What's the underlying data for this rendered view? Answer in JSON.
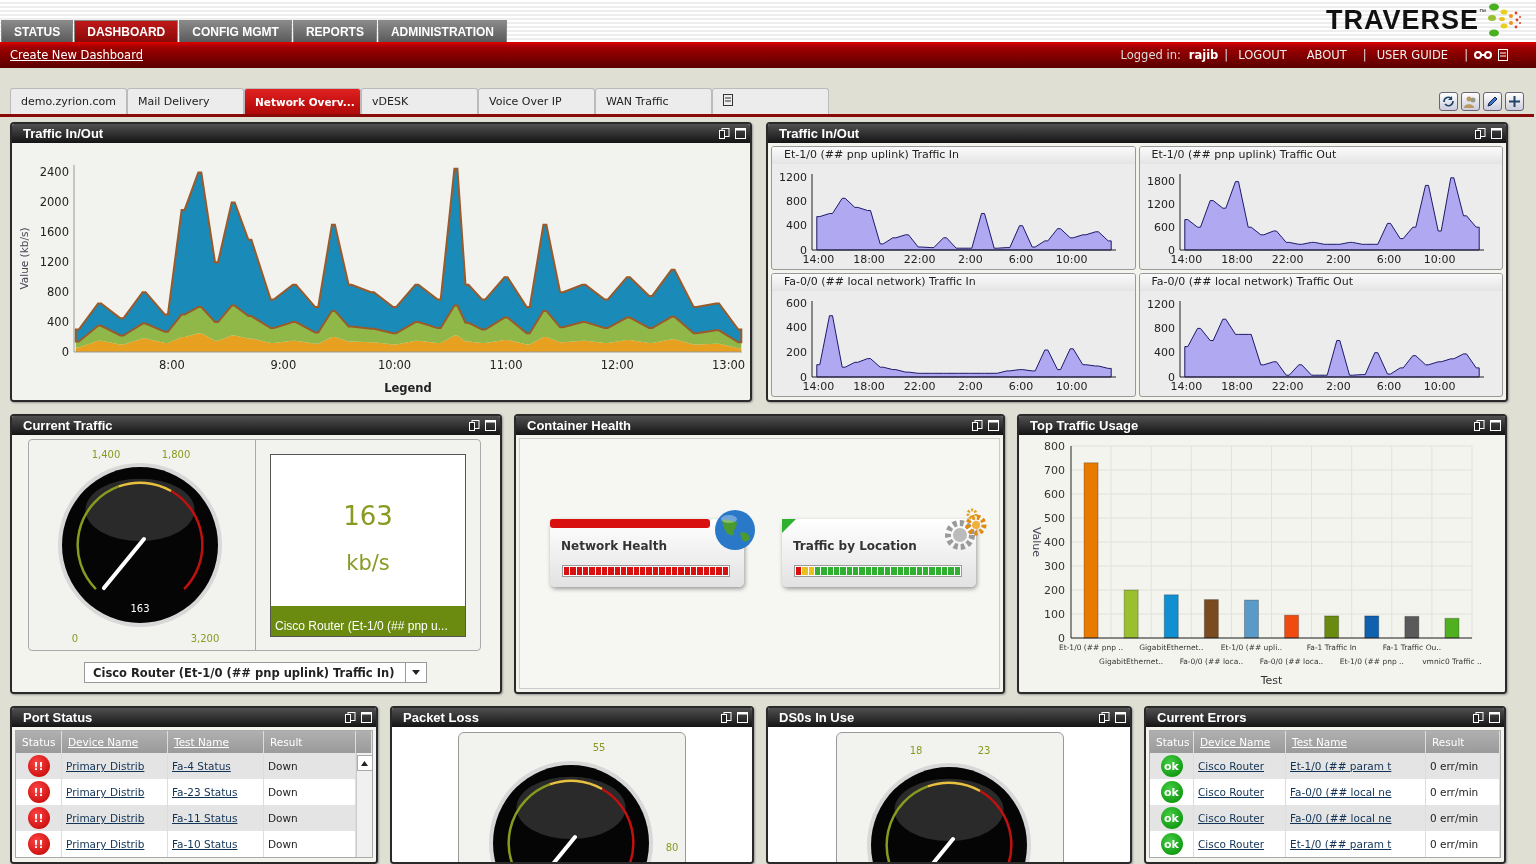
{
  "header": {
    "logo": "TRAVERSE",
    "logo_tm": "™",
    "nav": [
      {
        "label": "STATUS",
        "selected": false
      },
      {
        "label": "DASHBOARD",
        "selected": true
      },
      {
        "label": "CONFIG MGMT",
        "selected": false
      },
      {
        "label": "REPORTS",
        "selected": false
      },
      {
        "label": "ADMINISTRATION",
        "selected": false
      }
    ],
    "create_link": "Create New Dashboard",
    "account": [
      {
        "kind": "label",
        "text": "Logged in:"
      },
      {
        "kind": "user",
        "text": "rajib"
      },
      {
        "kind": "sep",
        "text": "|"
      },
      {
        "kind": "link",
        "text": "LOGOUT"
      },
      {
        "kind": "link",
        "text": "ABOUT"
      },
      {
        "kind": "sep",
        "text": "|"
      },
      {
        "kind": "link",
        "text": "USER GUIDE"
      },
      {
        "kind": "sep",
        "text": "|"
      }
    ]
  },
  "dashboard_tabs": [
    {
      "kind": "text",
      "label": "demo.zyrion.com",
      "selected": false
    },
    {
      "kind": "text",
      "label": "Mail Delivery",
      "selected": false
    },
    {
      "kind": "text",
      "label": "Network Overv...",
      "selected": true
    },
    {
      "kind": "text",
      "label": "vDESK",
      "selected": false
    },
    {
      "kind": "text",
      "label": "Voice Over IP",
      "selected": false
    },
    {
      "kind": "text",
      "label": "WAN Traffic",
      "selected": false
    },
    {
      "kind": "icon",
      "selected": false
    }
  ],
  "traffic_main": {
    "title": "Traffic In/Out",
    "chart_data": {
      "type": "area",
      "stacked": true,
      "xlabel": "Legend",
      "ylabel": "Value (kb/s)",
      "x": [
        7.15,
        7.35,
        7.55,
        7.75,
        7.95,
        8.1,
        8.25,
        8.4,
        8.55,
        8.7,
        8.9,
        9.1,
        9.3,
        9.45,
        9.6,
        9.8,
        10.0,
        10.2,
        10.4,
        10.55,
        10.65,
        10.8,
        11.0,
        11.2,
        11.35,
        11.5,
        11.7,
        11.9,
        12.1,
        12.3,
        12.5,
        12.7,
        12.9,
        13.1
      ],
      "series": [
        {
          "color": "#e8a020",
          "values": [
            60,
            150,
            100,
            180,
            120,
            200,
            250,
            150,
            220,
            180,
            120,
            150,
            110,
            200,
            140,
            130,
            100,
            150,
            120,
            220,
            140,
            120,
            160,
            100,
            200,
            130,
            150,
            120,
            160,
            120,
            170,
            100,
            110,
            50
          ]
        },
        {
          "color": "#8fb848",
          "values": [
            80,
            200,
            120,
            200,
            150,
            300,
            350,
            250,
            400,
            300,
            200,
            250,
            150,
            350,
            200,
            180,
            150,
            250,
            200,
            400,
            250,
            180,
            300,
            150,
            350,
            200,
            250,
            200,
            300,
            200,
            300,
            150,
            180,
            80
          ]
        },
        {
          "color": "#1a8ab8",
          "values": [
            160,
            300,
            230,
            420,
            230,
            1400,
            1800,
            800,
            1380,
            1020,
            380,
            500,
            340,
            1150,
            560,
            490,
            350,
            500,
            380,
            1830,
            510,
            400,
            540,
            350,
            1150,
            470,
            500,
            380,
            540,
            430,
            630,
            350,
            360,
            170
          ]
        }
      ],
      "xlim": [
        7.12,
        13.12
      ],
      "ylim": [
        0,
        2500
      ],
      "xticks": [
        {
          "value": 8,
          "label": "8:00"
        },
        {
          "value": 9,
          "label": "9:00"
        },
        {
          "value": 10,
          "label": "10:00"
        },
        {
          "value": 11,
          "label": "11:00"
        },
        {
          "value": 12,
          "label": "12:00"
        },
        {
          "value": 13,
          "label": "13:00"
        }
      ],
      "yticks": [
        0,
        400,
        800,
        1200,
        1600,
        2000,
        2400
      ]
    }
  },
  "traffic_mini": {
    "title": "Traffic In/Out",
    "charts": [
      {
        "title": "Et-1/0 (## pnp uplink) Traffic In",
        "chart_data": {
          "type": "area",
          "categories": [
            "14:00",
            null,
            null,
            null,
            "18:00",
            null,
            null,
            null,
            "22:00",
            null,
            null,
            null,
            "2:00",
            null,
            null,
            null,
            "6:00",
            null,
            null,
            null,
            "10:00",
            null,
            null,
            null
          ],
          "series": [
            {
              "color": "#b0a8f0",
              "values": [
                550,
                600,
                850,
                700,
                650,
                100,
                200,
                250,
                50,
                40,
                200,
                30,
                30,
                600,
                30,
                40,
                400,
                50,
                150,
                350,
                200,
                250,
                300,
                150
              ]
            }
          ],
          "ylim": [
            0,
            1250
          ],
          "yticks": [
            0,
            400,
            800,
            1200
          ]
        }
      },
      {
        "title": "Et-1/0 (## pnp uplink) Traffic Out",
        "chart_data": {
          "type": "area",
          "categories": [
            "14:00",
            null,
            null,
            null,
            "18:00",
            null,
            null,
            null,
            "22:00",
            null,
            null,
            null,
            "2:00",
            null,
            null,
            null,
            "6:00",
            null,
            null,
            null,
            "10:00",
            null,
            null,
            null
          ],
          "series": [
            {
              "color": "#b0a8f0",
              "values": [
                800,
                600,
                1300,
                1100,
                1800,
                600,
                400,
                500,
                200,
                150,
                200,
                150,
                150,
                200,
                150,
                150,
                700,
                300,
                600,
                1700,
                500,
                1900,
                900,
                600
              ]
            }
          ],
          "ylim": [
            0,
            2000
          ],
          "yticks": [
            0,
            600,
            1200,
            1800
          ]
        }
      },
      {
        "title": "Fa-0/0 (## local network) Traffic In",
        "chart_data": {
          "type": "area",
          "categories": [
            "14:00",
            null,
            null,
            null,
            "18:00",
            null,
            null,
            null,
            "22:00",
            null,
            null,
            null,
            "2:00",
            null,
            null,
            null,
            "6:00",
            null,
            null,
            null,
            "10:00",
            null,
            null,
            null
          ],
          "series": [
            {
              "color": "#b0a8f0",
              "values": [
                100,
                500,
                80,
                120,
                150,
                80,
                60,
                40,
                30,
                30,
                30,
                30,
                30,
                30,
                30,
                50,
                60,
                50,
                220,
                60,
                230,
                100,
                90,
                70
              ]
            }
          ],
          "ylim": [
            0,
            620
          ],
          "yticks": [
            0,
            200,
            400,
            600
          ]
        }
      },
      {
        "title": "Fa-0/0 (## local network) Traffic Out",
        "chart_data": {
          "type": "area",
          "categories": [
            "14:00",
            null,
            null,
            null,
            "18:00",
            null,
            null,
            null,
            "22:00",
            null,
            null,
            null,
            "2:00",
            null,
            null,
            null,
            "6:00",
            null,
            null,
            null,
            "10:00",
            null,
            null,
            null
          ],
          "series": [
            {
              "color": "#b0a8f0",
              "values": [
                500,
                800,
                600,
                950,
                700,
                700,
                200,
                250,
                30,
                200,
                30,
                30,
                600,
                30,
                40,
                400,
                50,
                150,
                350,
                200,
                250,
                300,
                380,
                150
              ]
            }
          ],
          "ylim": [
            0,
            1250
          ],
          "yticks": [
            0,
            400,
            800,
            1200
          ]
        }
      }
    ]
  },
  "current_traffic": {
    "title": "Current Traffic",
    "gauge": {
      "labels": [
        "1,400",
        "1,800",
        "0",
        "3,200"
      ],
      "value": "163"
    },
    "readout": {
      "value": "163",
      "unit": "kb/s",
      "caption": "Cisco Router (Et-1/0 (## pnp u..."
    },
    "select": {
      "value": "Cisco Router (Et-1/0 (## pnp uplink) Traffic In)"
    }
  },
  "container_health": {
    "title": "Container Health",
    "cards": [
      {
        "label": "Network Health",
        "color": "#d81010"
      },
      {
        "label": "Traffic by Location",
        "color": "#30b030"
      }
    ]
  },
  "top_traffic": {
    "title": "Top Traffic Usage",
    "chart_data": {
      "type": "bar",
      "xlabel": "Test",
      "ylabel": "Value",
      "grid": true,
      "categories": [
        "Et-1/0 (## pnp ..",
        "GigabitEthernet..",
        "GigabitEthernet..",
        "Fa-0/0 (## loca..",
        "Et-1/0 (## upli..",
        "Fa-0/0 (## loca..",
        "Fa-1 Traffic In",
        "Et-1/0 (## pnp ..",
        "Fa-1 Traffic Ou..",
        "vmnic0 Traffic .."
      ],
      "values": [
        730,
        200,
        180,
        160,
        158,
        95,
        92,
        92,
        90,
        82
      ],
      "colors": [
        "#e87a00",
        "#9ac030",
        "#1090d0",
        "#7a4a20",
        "#5a9ac8",
        "#f04a10",
        "#6a8a10",
        "#1060b0",
        "#5a5a5a",
        "#50b020"
      ],
      "ylim": [
        0,
        800
      ],
      "yticks": [
        0,
        100,
        200,
        300,
        400,
        500,
        600,
        700,
        800
      ]
    }
  },
  "port_status": {
    "title": "Port Status",
    "columns": [
      "Status",
      "Device Name",
      "Test Name",
      "Result"
    ],
    "rows": [
      {
        "kind": "critical",
        "icon_text": "!!",
        "device": "Primary Distrib",
        "test": "Fa-4 Status",
        "result": "Down"
      },
      {
        "kind": "critical",
        "icon_text": "!!",
        "device": "Primary Distrib",
        "test": "Fa-23 Status",
        "result": "Down"
      },
      {
        "kind": "critical",
        "icon_text": "!!",
        "device": "Primary Distrib",
        "test": "Fa-11 Status",
        "result": "Down"
      },
      {
        "kind": "critical",
        "icon_text": "!!",
        "device": "Primary Distrib",
        "test": "Fa-10 Status",
        "result": "Down"
      }
    ]
  },
  "packet_loss": {
    "title": "Packet Loss",
    "gauge": {
      "labels": [
        "55",
        "80"
      ]
    }
  },
  "ds0s": {
    "title": "DS0s In Use",
    "gauge": {
      "labels": [
        "18",
        "23"
      ]
    }
  },
  "current_errors": {
    "title": "Current Errors",
    "columns": [
      "Status",
      "Device Name",
      "Test Name",
      "Result"
    ],
    "rows": [
      {
        "kind": "ok",
        "icon_text": "ok",
        "device": "Cisco Router",
        "test": "Et-1/0 (## param t",
        "result": "0 err/min"
      },
      {
        "kind": "ok",
        "icon_text": "ok",
        "device": "Cisco Router",
        "test": "Fa-0/0 (## local ne",
        "result": "0 err/min"
      },
      {
        "kind": "ok",
        "icon_text": "ok",
        "device": "Cisco Router",
        "test": "Fa-0/0 (## local ne",
        "result": "0 err/min"
      },
      {
        "kind": "ok",
        "icon_text": "ok",
        "device": "Cisco Router",
        "test": "Et-1/0 (## param t",
        "result": "0 err/min"
      }
    ]
  }
}
